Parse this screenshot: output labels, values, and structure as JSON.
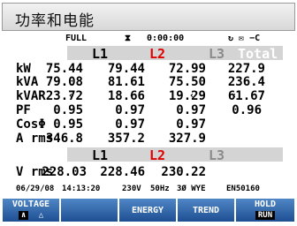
{
  "title": "功率和电能",
  "status": {
    "mode": "FULL",
    "clock_icon": "clock-icon",
    "elapsed": "0:00:00",
    "icons_text": "↻ ✉ −C",
    "icon_names": [
      "refresh-icon",
      "memory-icon",
      "battery-plug-icon"
    ]
  },
  "headers": {
    "top": [
      "L1",
      "L2",
      "L3",
      "Total"
    ],
    "bottom": [
      "L1",
      "L2",
      "L3"
    ],
    "colors": {
      "L1": "#000000",
      "L2": "#e00000",
      "L3": "#8a8a8a",
      "Total": "#ffffff",
      "band": "#d4d4d4"
    }
  },
  "rows": [
    {
      "label": "kW",
      "values": [
        "75.44",
        "79.44",
        "72.99",
        "227.9"
      ]
    },
    {
      "label": "kVA",
      "values": [
        "79.08",
        "81.61",
        "75.50",
        "236.4"
      ]
    },
    {
      "label": "kVAR",
      "values": [
        "23.72",
        "18.66",
        "19.29",
        "61.67"
      ],
      "prefix": "‹"
    },
    {
      "label": "PF",
      "values": [
        "0.95",
        "0.97",
        "0.97",
        "0.96"
      ]
    },
    {
      "label": "CosΦ",
      "values": [
        "0.95",
        "0.97",
        "0.97",
        ""
      ]
    },
    {
      "label": "A rms",
      "values": [
        "346.8",
        "357.2",
        "327.9",
        ""
      ]
    }
  ],
  "vrow": {
    "label": "V rms",
    "values": [
      "228.03",
      "228.46",
      "230.22"
    ]
  },
  "info": {
    "date": "06/29/08",
    "time": "14:13:20",
    "voltage": "230V",
    "freq": "50Hz",
    "config": "3Ø WYE",
    "standard": "EN50160"
  },
  "softkeys": {
    "f1": {
      "label": "VOLTAGE",
      "sub_left": "∧",
      "sub_right": "△"
    },
    "f2": {
      "label": ""
    },
    "f3": {
      "label": "ENERGY"
    },
    "f4": {
      "label": "TREND"
    },
    "f5": {
      "label": "HOLD",
      "sub": "RUN"
    }
  }
}
